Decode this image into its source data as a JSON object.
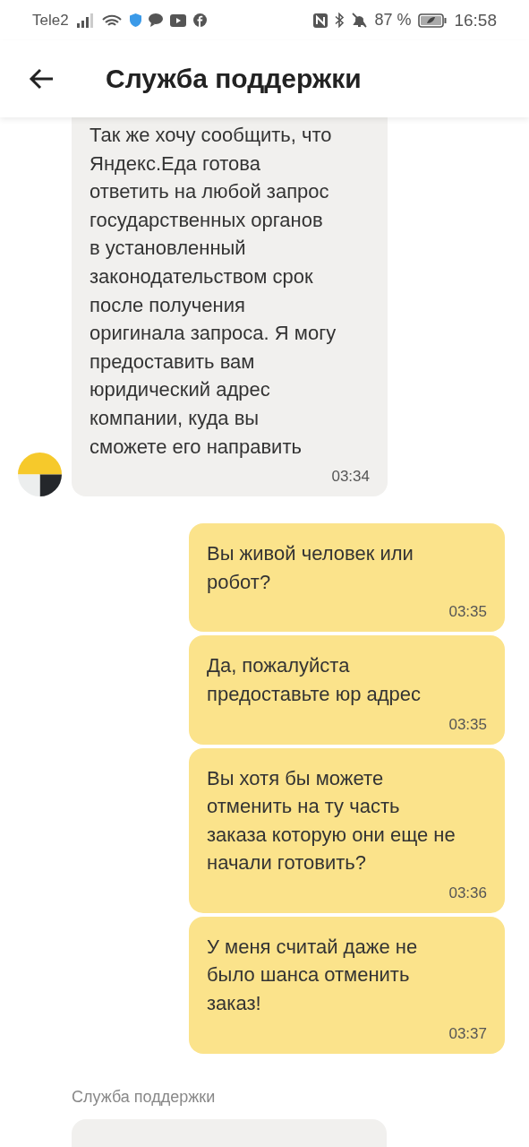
{
  "status_bar": {
    "carrier": "Tele2",
    "battery": "87 %",
    "time": "16:58"
  },
  "header": {
    "title": "Служба поддержки"
  },
  "messages": [
    {
      "kind": "incoming",
      "text": "Так же хочу сообщить, что\nЯндекс.Еда готова\nответить на любой запрос\nгосударственных органов\nв установленный\nзаконодательством срок\nпосле получения\nоригинала запроса. Я могу\nпредоставить вам\nюридический адрес\nкомпании, куда вы\nсможете его направить",
      "time": "03:34",
      "avatar": true
    },
    {
      "kind": "outgoing",
      "text": "Вы живой человек или\nробот?",
      "time": "03:35"
    },
    {
      "kind": "outgoing",
      "text": "Да, пожалуйста\nпредоставьте юр адрес",
      "time": "03:35"
    },
    {
      "kind": "outgoing",
      "text": "Вы хотя бы можете\nотменить на ту часть\nзаказа которую они еще не\nначали готовить?",
      "time": "03:36"
    },
    {
      "kind": "outgoing",
      "text": "У меня считай даже не\nбыло шанса отменить\nзаказ!",
      "time": "03:37"
    }
  ],
  "next_group": {
    "sender": "Служба поддержки"
  }
}
